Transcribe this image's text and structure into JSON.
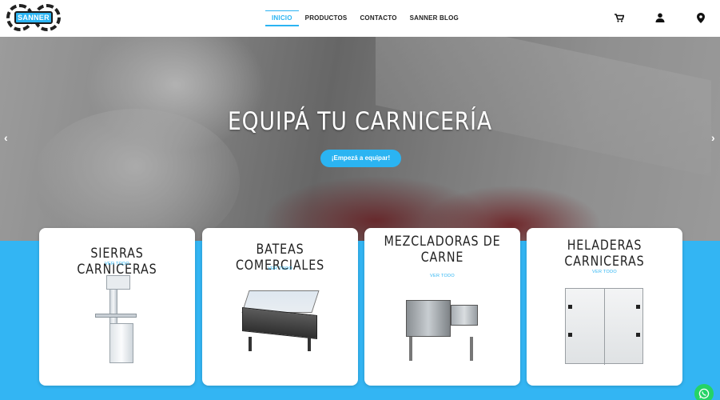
{
  "header": {
    "logo_text": "SANNER",
    "nav": [
      {
        "label": "INICIO",
        "active": true
      },
      {
        "label": "PRODUCTOS",
        "active": false
      },
      {
        "label": "CONTACTO",
        "active": false
      },
      {
        "label": "SANNER BLOG",
        "active": false
      }
    ],
    "icons": [
      "cart-icon",
      "user-icon",
      "map-pin-icon"
    ]
  },
  "hero": {
    "title": "EQUIPÁ TU CARNICERÍA",
    "cta_label": "¡Empezá a equipar!",
    "prev_arrow": "‹",
    "next_arrow": "›"
  },
  "categories": [
    {
      "title": "SIERRAS CARNICERAS",
      "link": "VER TODO"
    },
    {
      "title": "BATEAS COMERCIALES",
      "link": "VER TODO"
    },
    {
      "title": "MEZCLADORAS DE CARNE",
      "link": "VER TODO"
    },
    {
      "title": "HELADERAS CARNICERAS",
      "link": "VER TODO"
    }
  ],
  "colors": {
    "accent": "#2bb4f2",
    "band": "#33b5f3",
    "whatsapp": "#25d366"
  }
}
